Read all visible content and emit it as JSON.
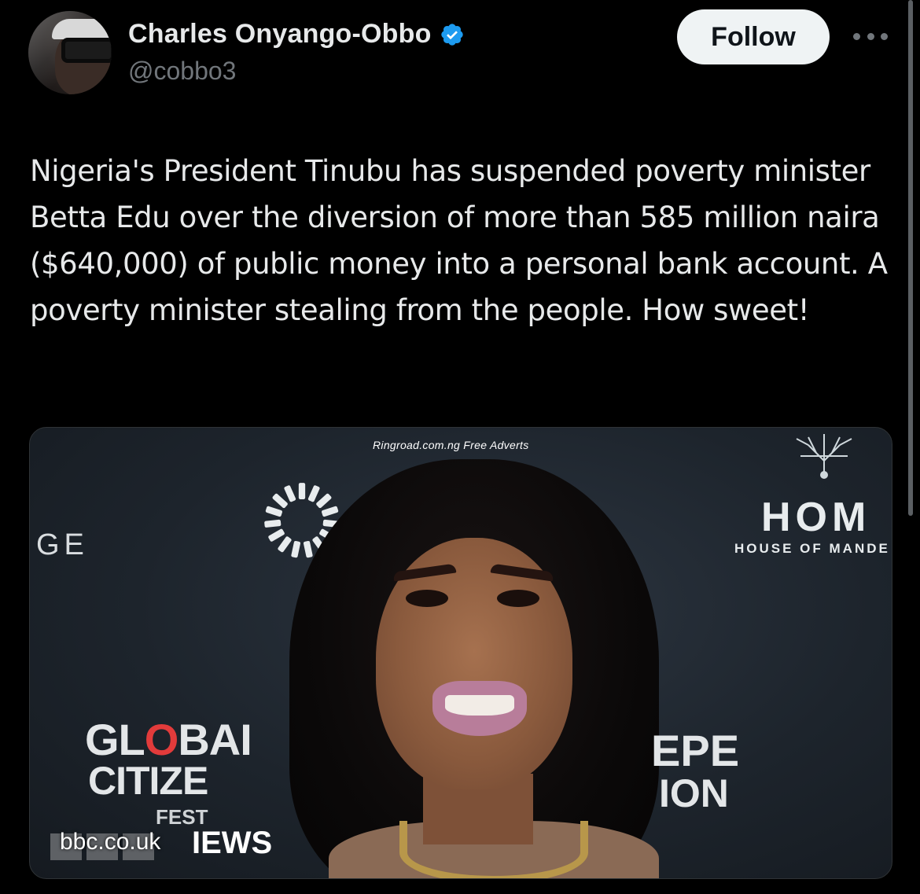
{
  "author": {
    "display_name": "Charles Onyango-Obbo",
    "handle": "@cobbo3",
    "verified": true
  },
  "actions": {
    "follow_label": "Follow",
    "more_icon": "more-horizontal-icon"
  },
  "tweet": {
    "text": "Nigeria's President Tinubu has suspended poverty minister Betta Edu over the diversion of more than 585 million naira ($640,000) of public money into a personal bank account. A poverty minister stealing from the people. How sweet!"
  },
  "media": {
    "watermark": "Ringroad.com.ng Free Adverts",
    "backdrop_left": "GE",
    "sponsor_logo": "HOM",
    "sponsor_name": "HOUSE OF MANDE",
    "festival_line1_pre": "GL",
    "festival_line1_o": "O",
    "festival_line1_post": "BAI",
    "festival_line2": "CITIZE",
    "festival_line3": "FEST",
    "backdrop_right_1": "EPE",
    "backdrop_right_2": "ION",
    "link_domain": "bbc.co.uk",
    "news_badge": "IEWS"
  },
  "colors": {
    "background": "#000000",
    "text_primary": "#e7e9ea",
    "text_secondary": "#71767b",
    "verified_blue": "#1d9bf0",
    "follow_bg": "#eff3f4",
    "follow_text": "#0f1419"
  }
}
